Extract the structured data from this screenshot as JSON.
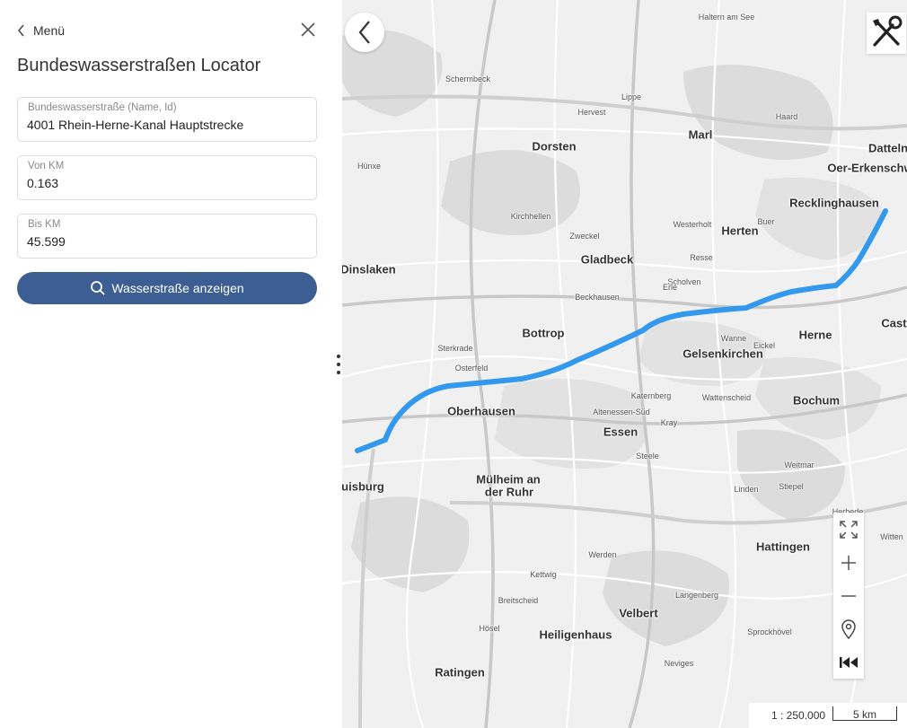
{
  "panel": {
    "menu_label": "Menü",
    "title": "Bundeswasserstraßen Locator",
    "fields": {
      "wasserstrasse": {
        "label": "Bundeswasserstraße (Name, Id)",
        "value": "4001 Rhein-Herne-Kanal Hauptstrecke"
      },
      "von_km": {
        "label": "Von KM",
        "value": "0.163"
      },
      "bis_km": {
        "label": "Bis KM",
        "value": "45.599"
      }
    },
    "show_button": "Wasserstraße anzeigen",
    "accent_color": "#3d5e92"
  },
  "map": {
    "route_color": "#3399ee",
    "places_major": [
      "Dorsten",
      "Marl",
      "Recklinghausen",
      "Herten",
      "Gladbeck",
      "Bottrop",
      "Gelsenkirchen",
      "Herne",
      "Oberhausen",
      "Essen",
      "Bochum",
      "Mülheim an",
      "der Ruhr",
      "Hattingen",
      "Velbert",
      "Heiligenhaus",
      "Ratingen",
      "Dinslaken",
      "uisburg",
      "Datteln",
      "Oer-Erkenschw",
      "Haltern am See",
      "Castr"
    ],
    "places_minor": [
      "Schermbeck",
      "Hünxe",
      "Kirchhellen",
      "Zweckel",
      "Westerholt",
      "Wanne",
      "Eickel",
      "Sterkrade",
      "Osterfeld",
      "Altenessen-Süd",
      "Kettwig",
      "Werden",
      "Witten",
      "Sprockhövel",
      "Langenberg",
      "Neviges",
      "Breitscheid",
      "Hösel",
      "Hervest",
      "Lippe",
      "Haard",
      "Scholven",
      "Buer",
      "Resse",
      "Erle",
      "Beckhausen",
      "Katernberg",
      "Kray",
      "Steele",
      "Wattenscheid",
      "Weitmar",
      "Linden",
      "Stiepel",
      "Herbede"
    ],
    "scale": {
      "ratio": "1 : 250.000",
      "distance": "5 km"
    }
  }
}
